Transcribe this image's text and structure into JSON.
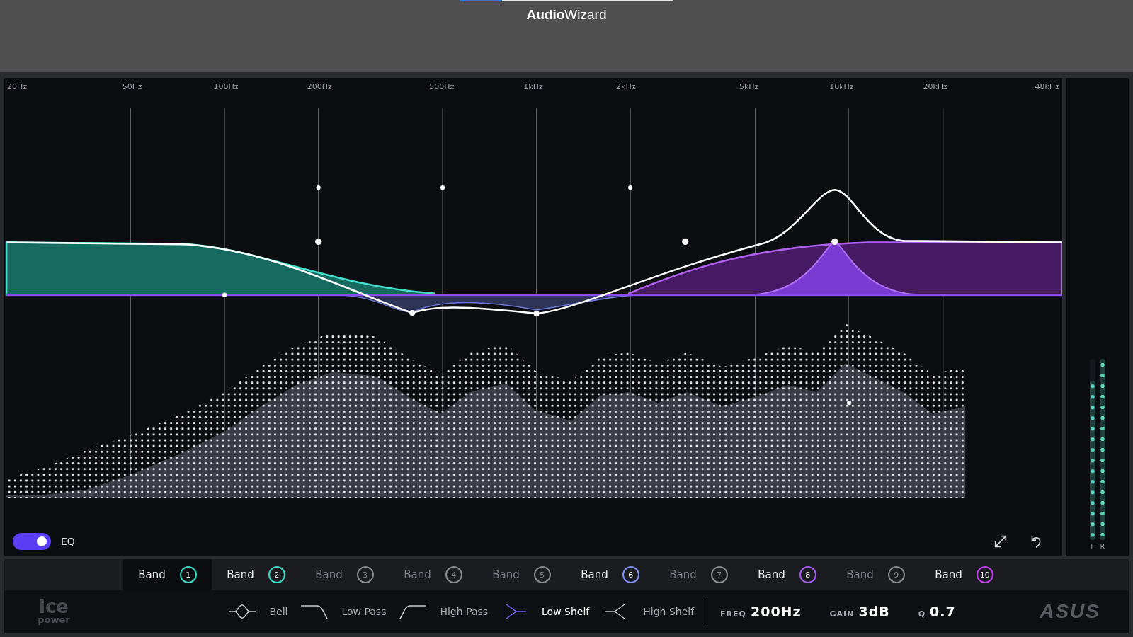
{
  "app": {
    "title": "**Audio**Wizard"
  },
  "eq": {
    "frequency_labels": [
      "20Hz",
      "50Hz",
      "100Hz",
      "200Hz",
      "500Hz",
      "1kHz",
      "2kHz",
      "5kHz",
      "10kHz",
      "20kHz",
      "48kHz"
    ],
    "toggle": {
      "label": "EQ",
      "on": true
    }
  },
  "meter": {
    "channels": [
      {
        "name": "L",
        "level": 0.88
      },
      {
        "name": "R",
        "level": 1
      }
    ]
  },
  "bands": [
    {
      "label": "Band",
      "number": "1",
      "active": true,
      "selected": true,
      "color": "#3ed8c6"
    },
    {
      "label": "Band",
      "number": "2",
      "active": true,
      "selected": false,
      "color": "#3ed8c6"
    },
    {
      "label": "Band",
      "number": "3",
      "active": false,
      "selected": false
    },
    {
      "label": "Band",
      "number": "4",
      "active": false,
      "selected": false
    },
    {
      "label": "Band",
      "number": "5",
      "active": false,
      "selected": false
    },
    {
      "label": "Band",
      "number": "6",
      "active": true,
      "selected": false,
      "color": "#7e8ef2"
    },
    {
      "label": "Band",
      "number": "7",
      "active": false,
      "selected": false
    },
    {
      "label": "Band",
      "number": "8",
      "active": true,
      "selected": false,
      "color": "#a45cf0"
    },
    {
      "label": "Band",
      "number": "9",
      "active": false,
      "selected": false
    },
    {
      "label": "Band",
      "number": "10",
      "active": true,
      "selected": false,
      "color": "#c43cf0"
    }
  ],
  "filters": [
    {
      "kind": "bell",
      "label": "Bell",
      "selected": false
    },
    {
      "kind": "low_pass",
      "label": "Low Pass",
      "selected": false
    },
    {
      "kind": "high_pass",
      "label": "High Pass",
      "selected": false
    },
    {
      "kind": "low_shelf",
      "label": "Low Shelf",
      "selected": true
    },
    {
      "kind": "high_shelf",
      "label": "High Shelf",
      "selected": false
    }
  ],
  "parameters": [
    {
      "name": "FREQ",
      "value": "200Hz"
    },
    {
      "name": "GAIN",
      "value": "3dB"
    },
    {
      "name": "Q",
      "value": "0.7"
    }
  ],
  "logos": {
    "left": [
      "ice",
      "power"
    ],
    "right": "ASUS"
  }
}
